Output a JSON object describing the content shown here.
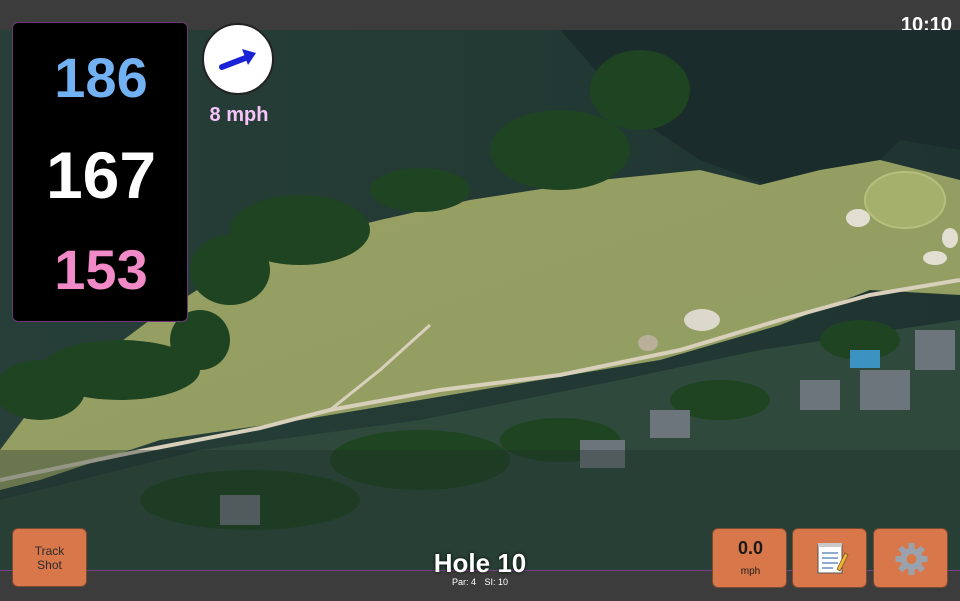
{
  "clock": "10:10",
  "distances": {
    "back": "186",
    "middle": "167",
    "front": "153",
    "back_color": "#72b2f2",
    "middle_color": "#ffffff",
    "front_color": "#f28ac8"
  },
  "wind": {
    "speed_text": "8 mph",
    "arrow_icon": "wind-direction-arrow",
    "arrow_color": "#1a22d8",
    "text_color": "#f6c4f8"
  },
  "buttons": {
    "track_shot": "Track\nShot",
    "speed_value": "0.0",
    "speed_unit": "mph",
    "notes_icon": "notepad-icon",
    "settings_icon": "gear-icon",
    "color": "#d8774a"
  },
  "hole": {
    "title": "Hole 10",
    "par": "Par: 4",
    "stroke_index": "SI: 10"
  },
  "colors": {
    "frame_border": "#7b3f8c",
    "bar_background": "#3c3c3c"
  }
}
